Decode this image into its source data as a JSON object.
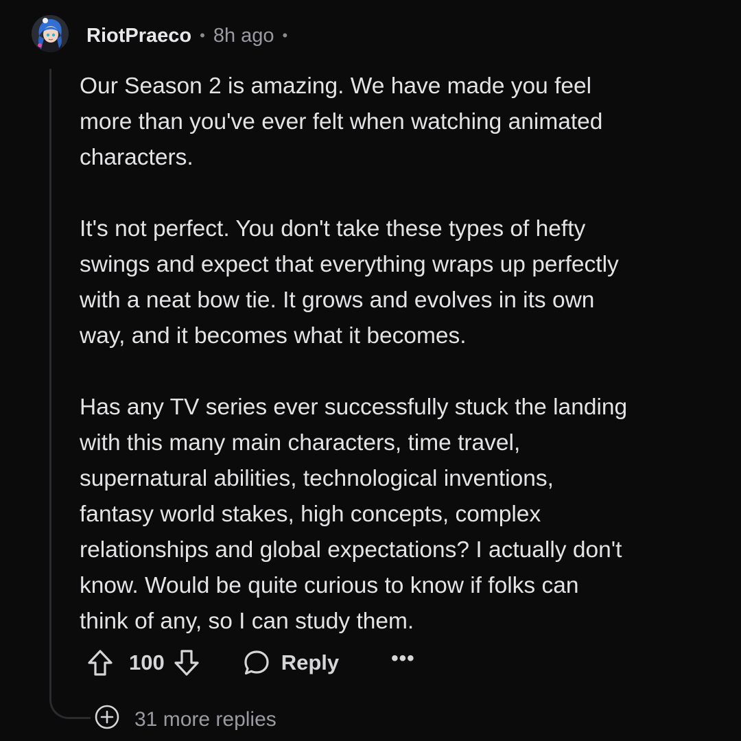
{
  "comment": {
    "username": "RiotPraeco",
    "timestamp": "8h ago",
    "separator": "•",
    "paragraphs": [
      "Our Season 2 is amazing. We have made you feel\nmore than you've ever felt when watching animated\ncharacters.",
      "It's not perfect. You don't take these types of hefty\nswings and expect that everything wraps up perfectly\nwith a neat bow tie. It grows and evolves in its own\nway, and it becomes what it becomes.",
      "Has any TV series ever successfully stuck the landing\nwith this many main characters, time travel,\nsupernatural abilities, technological inventions,\nfantasy world stakes, high concepts, complex\nrelationships and global expectations? I actually don't\nknow. Would be quite curious to know if folks can\nthink of any, so I can study them."
    ]
  },
  "actions": {
    "vote_count": "100",
    "reply_label": "Reply",
    "more_label": "•••"
  },
  "replies": {
    "more_label": "31 more replies"
  },
  "icons": {
    "upvote": "arrow-up-icon",
    "downvote": "arrow-down-icon",
    "reply": "speech-bubble-icon",
    "expand": "plus-circle-icon"
  },
  "colors": {
    "background": "#0b0b0c",
    "text": "#e4e4e6",
    "muted": "#9a9aa0",
    "thread_line": "#2b2b2f"
  }
}
